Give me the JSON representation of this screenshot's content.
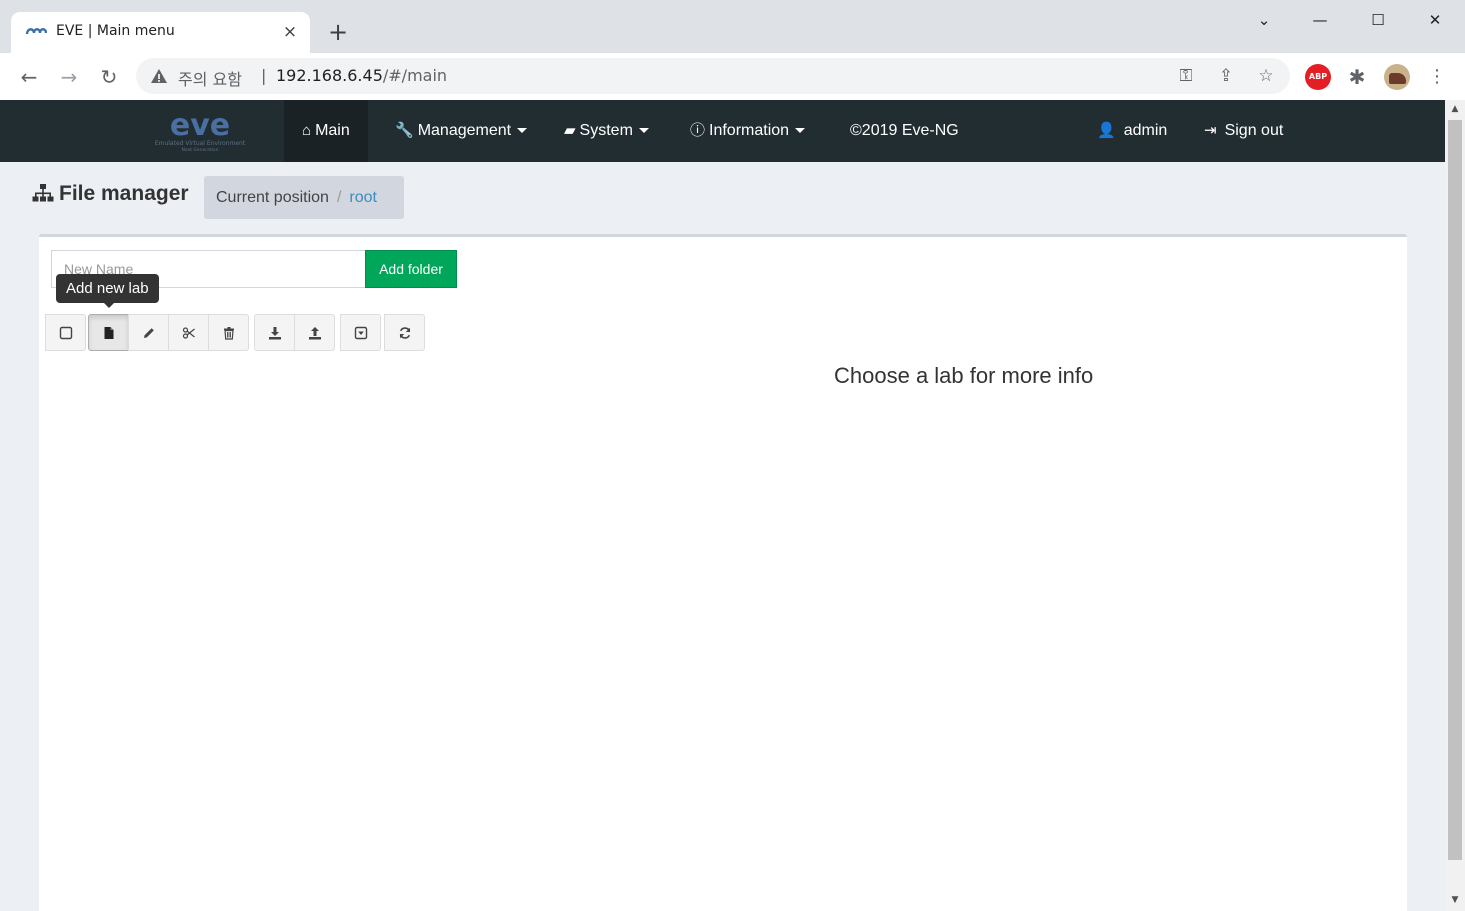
{
  "browser": {
    "tab_title": "EVE | Main menu",
    "tab_close": "×",
    "new_tab": "+",
    "security_label": "주의 요함",
    "url_host": "192.168.6.45",
    "url_path": "/#/main",
    "window_controls": {
      "minimize": "—",
      "maximize": "☐",
      "close": "✕",
      "tab_search": "⌄"
    }
  },
  "navbar": {
    "logo_text": "eve",
    "logo_subtitle": "Emulated Virtual Environment",
    "logo_subtitle2": "Next Generation",
    "items": [
      {
        "label": "Main",
        "icon": "home-icon"
      },
      {
        "label": "Management",
        "icon": "wrench-icon"
      },
      {
        "label": "System",
        "icon": "book-icon"
      },
      {
        "label": "Information",
        "icon": "info-icon"
      },
      {
        "label": "©2019 Eve-NG"
      }
    ],
    "user": {
      "label": "admin",
      "icon": "user-icon"
    },
    "signout": {
      "label": "Sign out",
      "icon": "sign-out-icon"
    }
  },
  "content_header": {
    "title": "File manager",
    "breadcrumb": {
      "static": "Current position",
      "separator": "/",
      "link": "root"
    }
  },
  "file_manager": {
    "new_name_placeholder": "New Name",
    "add_folder_label": "Add folder",
    "tooltip": "Add new lab",
    "info_message": "Choose a lab for more info"
  },
  "colors": {
    "navbar_bg": "#222d32",
    "success": "#00a65a",
    "link": "#3c8dbc",
    "page_bg": "#ecf0f5"
  }
}
